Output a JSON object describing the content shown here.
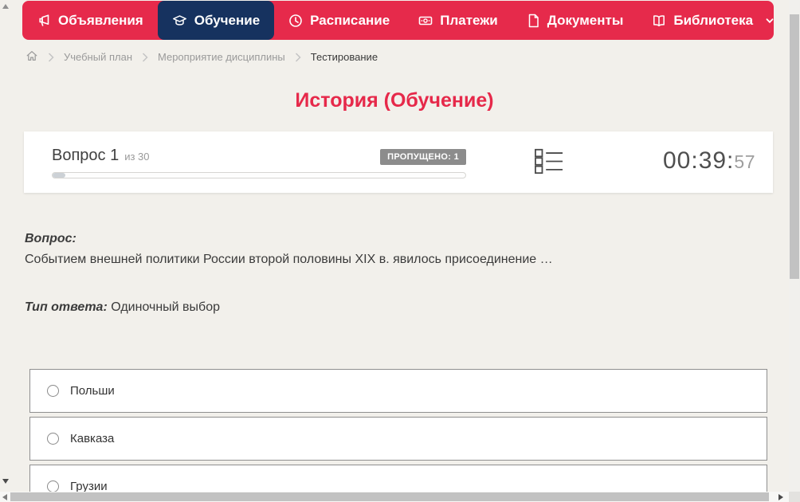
{
  "nav": {
    "items": [
      {
        "label": "Объявления",
        "icon": "megaphone-icon",
        "active": false
      },
      {
        "label": "Обучение",
        "icon": "graduation-cap-icon",
        "active": true
      },
      {
        "label": "Расписание",
        "icon": "clock-icon",
        "active": false
      },
      {
        "label": "Платежи",
        "icon": "banknote-icon",
        "active": false
      },
      {
        "label": "Документы",
        "icon": "document-icon",
        "active": false
      },
      {
        "label": "Библиотека",
        "icon": "book-icon",
        "active": false,
        "has_dropdown": true
      }
    ]
  },
  "breadcrumb": {
    "items": [
      "Учебный план",
      "Мероприятие дисциплины",
      "Тестирование"
    ]
  },
  "page_title": "История (Обучение)",
  "question_panel": {
    "question_label": "Вопрос 1",
    "question_of": "из 30",
    "skipped_badge": "ПРОПУЩЕНО: 1",
    "progress_percent": 3,
    "timer_hm": "00:39:",
    "timer_seconds": "57"
  },
  "question": {
    "label": "Вопрос:",
    "text": "Событием внешней политики России второй половины XIX в. явилось присоединение …",
    "answer_type_label": "Тип ответа:",
    "answer_type_value": "Одиночный выбор"
  },
  "options": [
    {
      "label": "Польши"
    },
    {
      "label": "Кавказа"
    },
    {
      "label": "Грузии"
    }
  ],
  "colors": {
    "navbar_red": "#e62a4b",
    "active_tab_navy": "#16325f",
    "title_red": "#e6294a",
    "page_bg": "#f2f0eb",
    "badge_gray": "#8c8c8c",
    "panel_bg": "#ffffff",
    "option_border": "#8f8f8f"
  }
}
